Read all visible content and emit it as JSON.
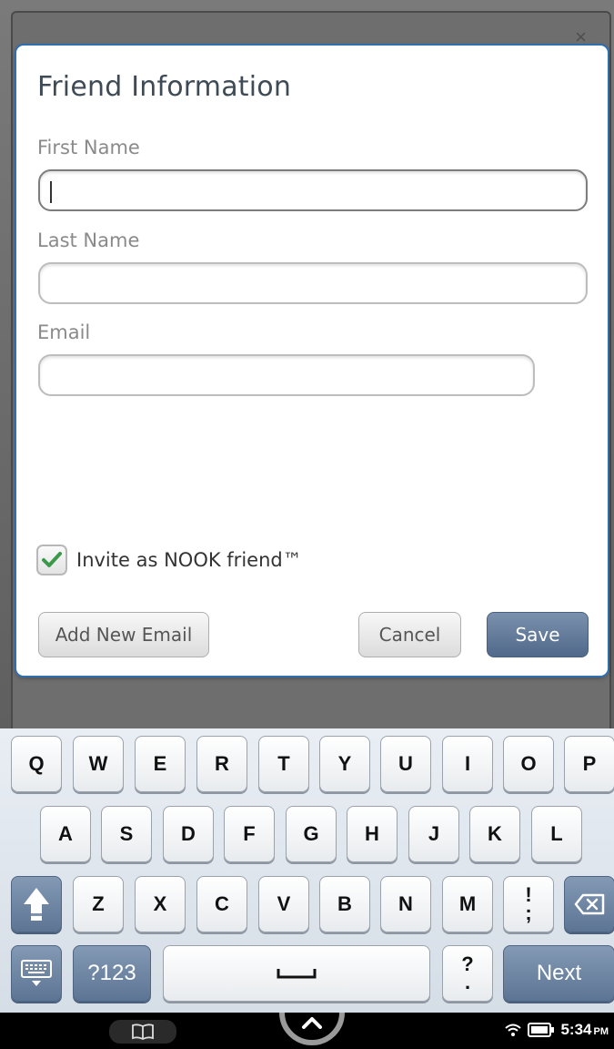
{
  "dialog": {
    "title": "Friend Information",
    "first_name": {
      "label": "First Name",
      "value": "",
      "placeholder": ""
    },
    "last_name": {
      "label": "Last Name",
      "value": "",
      "placeholder": ""
    },
    "email": {
      "label": "Email",
      "value": "",
      "placeholder": ""
    },
    "invite_checkbox": {
      "label": "Invite as NOOK friend™",
      "checked": true
    },
    "buttons": {
      "add_email": "Add New Email",
      "cancel": "Cancel",
      "save": "Save"
    }
  },
  "keyboard": {
    "row1": [
      "Q",
      "W",
      "E",
      "R",
      "T",
      "Y",
      "U",
      "I",
      "O",
      "P"
    ],
    "row2": [
      "A",
      "S",
      "D",
      "F",
      "G",
      "H",
      "J",
      "K",
      "L"
    ],
    "row3": [
      "Z",
      "X",
      "C",
      "V",
      "B",
      "N",
      "M"
    ],
    "punct_top": "!",
    "punct_bottom": ";",
    "question_top": "?",
    "question_bottom": ".",
    "symbols": "?123",
    "next": "Next"
  },
  "statusbar": {
    "time": "5:34",
    "ampm": "PM"
  },
  "colors": {
    "accent_blue": "#2f6fb0",
    "save_button": "#5d7594",
    "check_green": "#3a9a4a"
  }
}
